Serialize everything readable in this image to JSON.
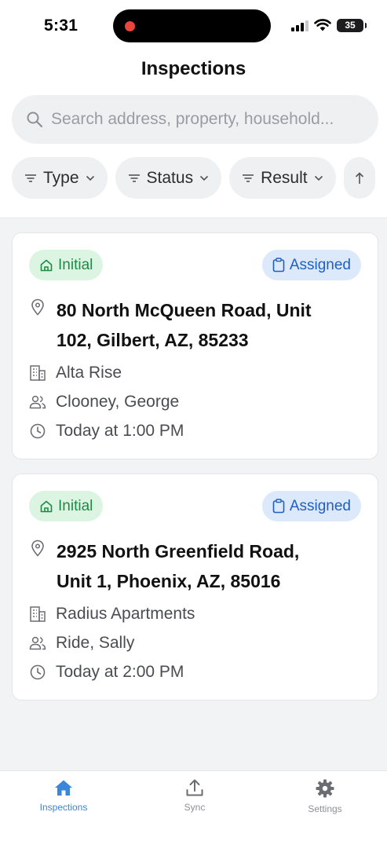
{
  "status_bar": {
    "time": "5:31",
    "battery": "35"
  },
  "header": {
    "title": "Inspections"
  },
  "search": {
    "placeholder": "Search address, property, household..."
  },
  "filters": [
    {
      "label": "Type"
    },
    {
      "label": "Status"
    },
    {
      "label": "Result"
    }
  ],
  "inspections": [
    {
      "type": "Initial",
      "status": "Assigned",
      "address_line1": "80 North McQueen Road, Unit",
      "address_line2": "102, Gilbert, AZ, 85233",
      "property": "Alta Rise",
      "household": "Clooney, George",
      "time": "Today at 1:00 PM"
    },
    {
      "type": "Initial",
      "status": "Assigned",
      "address_line1": "2925 North Greenfield Road,",
      "address_line2": "Unit 1, Phoenix, AZ, 85016",
      "property": "Radius Apartments",
      "household": "Ride, Sally",
      "time": "Today at 2:00 PM"
    }
  ],
  "tabs": [
    {
      "label": "Inspections",
      "icon": "home-icon",
      "active": true
    },
    {
      "label": "Sync",
      "icon": "upload-icon"
    },
    {
      "label": "Settings",
      "icon": "gear-icon"
    }
  ],
  "colors": {
    "accent": "#3a86d9",
    "type_badge_bg": "#dcf5e3",
    "type_badge_text": "#1e8a44",
    "status_badge_bg": "#dce9fb",
    "status_badge_text": "#1f5fbf"
  }
}
